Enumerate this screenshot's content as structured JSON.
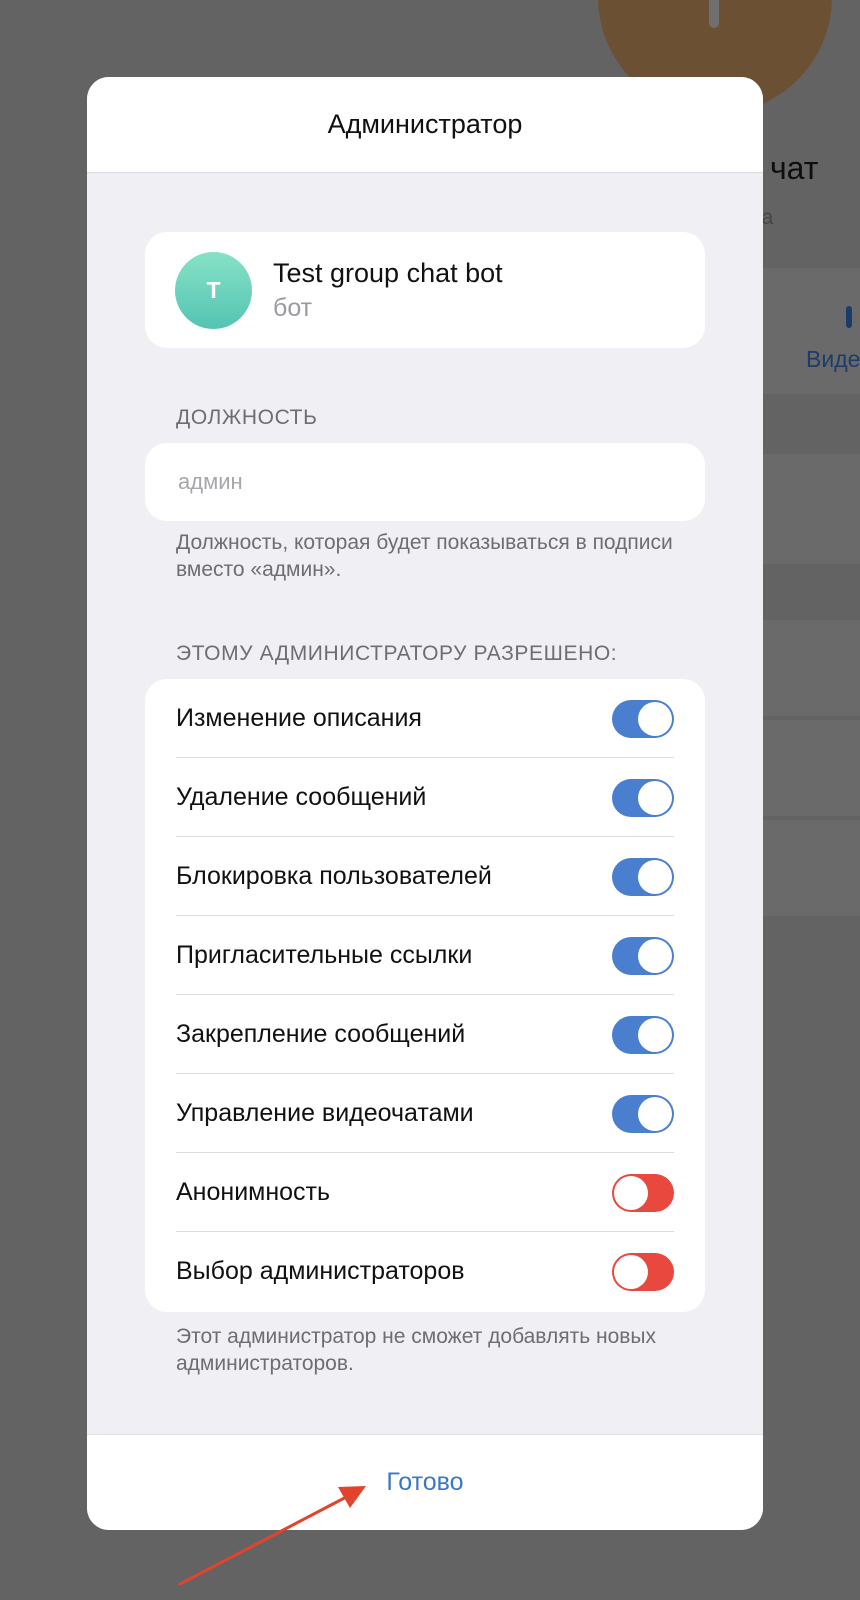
{
  "background": {
    "title_fragment": "чат",
    "subtitle_fragment": "ка",
    "action_fragment": "Виде"
  },
  "modal": {
    "title": "Администратор",
    "profile": {
      "avatar_letter": "T",
      "name": "Test group chat bot",
      "subtitle": "бот"
    },
    "custom_title": {
      "caption": "ДОЛЖНОСТЬ",
      "placeholder": "админ",
      "value": "",
      "hint": "Должность, которая будет показываться в подписи вместо «админ»."
    },
    "permissions": {
      "caption": "ЭТОМУ АДМИНИСТРАТОРУ РАЗРЕШЕНО:",
      "items": [
        {
          "label": "Изменение описания",
          "enabled": true
        },
        {
          "label": "Удаление сообщений",
          "enabled": true
        },
        {
          "label": "Блокировка пользователей",
          "enabled": true
        },
        {
          "label": "Пригласительные ссылки",
          "enabled": true
        },
        {
          "label": "Закрепление сообщений",
          "enabled": true
        },
        {
          "label": "Управление видеочатами",
          "enabled": true
        },
        {
          "label": "Анонимность",
          "enabled": false
        },
        {
          "label": "Выбор администраторов",
          "enabled": false
        }
      ],
      "hint": "Этот администратор не сможет добавлять новых администраторов."
    },
    "done_label": "Готово"
  },
  "colors": {
    "switch_on": "#4a7fd0",
    "switch_off": "#e8483e",
    "link_blue": "#3b77c8",
    "annotation_arrow": "#e2432d"
  }
}
